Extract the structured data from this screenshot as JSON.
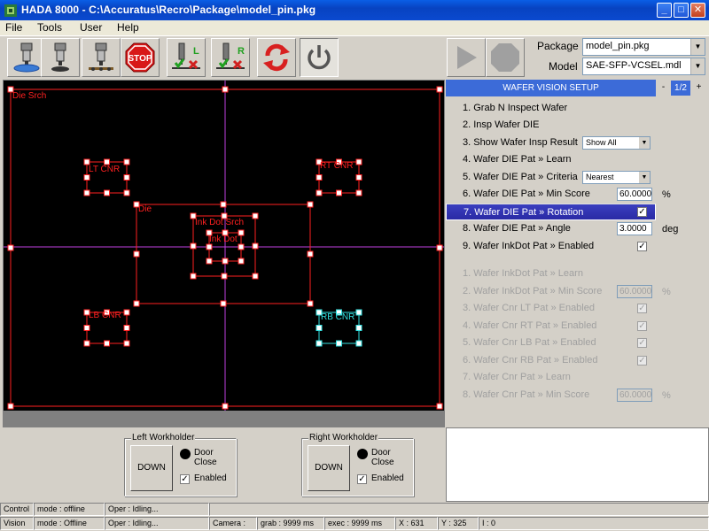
{
  "window": {
    "title": "HADA 8000 - C:\\Accuratus\\Recro\\Package\\model_pin.pkg"
  },
  "menu": {
    "items": [
      "File",
      "Tools",
      "User",
      "Help"
    ]
  },
  "toolbar": {
    "buttons": [
      "camera-lower-icon",
      "camera-mid-icon",
      "camera-upper-icon",
      "stop-icon",
      "learn-left-icon",
      "learn-right-icon",
      "refresh-icon",
      "power-icon"
    ],
    "stop_label": "STOP",
    "learn_left_letter": "L",
    "learn_right_letter": "R",
    "package_label": "Package",
    "package_value": "model_pin.pkg",
    "model_label": "Model",
    "model_value": "SAE-SFP-VCSEL.mdl"
  },
  "canvas": {
    "labels": {
      "die_srch": "Die Srch",
      "lt_cnr": "LT CNR",
      "rt_cnr": "RT CNR",
      "die": "Die",
      "ink_dot_srch": "Ink Dot Srch",
      "ink_dot": "Ink Dot",
      "lb_cnr": "LB CNR",
      "rb_cnr": "RB CNR"
    },
    "colors": {
      "roi": "#ff2020",
      "selected_roi": "#30e0e0",
      "crosshair": "#c040e0"
    }
  },
  "setup": {
    "title": "WAFER VISION SETUP",
    "page_minus": "-",
    "page_plus": "+",
    "page": "1/2",
    "rows": [
      "1. Grab N Inspect Wafer",
      "2. Insp Wafer DIE",
      "3. Show Wafer Insp Result",
      "4. Wafer DIE Pat » Learn",
      "5. Wafer DIE Pat » Criteria",
      "6. Wafer DIE Pat » Min Score",
      "7. Wafer DIE Pat » Rotation",
      "8. Wafer DIE Pat » Angle",
      "9. Wafer InkDot Pat » Enabled",
      "1. Wafer InkDot Pat » Learn",
      "2. Wafer InkDot Pat » Min Score",
      "3. Wafer Cnr LT Pat » Enabled",
      "4. Wafer Cnr RT Pat » Enabled",
      "5. Wafer Cnr LB Pat » Enabled",
      "6. Wafer Cnr RB Pat » Enabled",
      "7. Wafer Cnr Pat » Learn",
      "8. Wafer Cnr Pat » Min Score"
    ],
    "show_result_value": "Show All",
    "criteria_value": "Nearest",
    "min_score_value": "60.0000",
    "min_score_unit": "%",
    "angle_value": "3.0000",
    "angle_unit": "deg",
    "inkdot_min_score_value": "60.0000",
    "inkdot_min_score_unit": "%",
    "cnr_min_score_value": "60.0000",
    "cnr_min_score_unit": "%",
    "check_mark": "✓"
  },
  "workholders": {
    "left": {
      "title": "Left Workholder",
      "button": "DOWN",
      "door": "Door Close",
      "enabled": "Enabled"
    },
    "right": {
      "title": "Right Workholder",
      "button": "DOWN",
      "door": "Door Close",
      "enabled": "Enabled"
    }
  },
  "status": {
    "control": {
      "name": "Control",
      "mode": "mode : offline",
      "oper": "Oper : Idling..."
    },
    "vision": {
      "name": "Vision",
      "mode": "mode : Offline",
      "oper": "Oper : Idling...",
      "camera": "Camera :",
      "grab": "grab : 9999 ms",
      "exec": "exec : 9999 ms",
      "x": "X : 631",
      "y": "Y : 325",
      "i": "I : 0"
    }
  }
}
